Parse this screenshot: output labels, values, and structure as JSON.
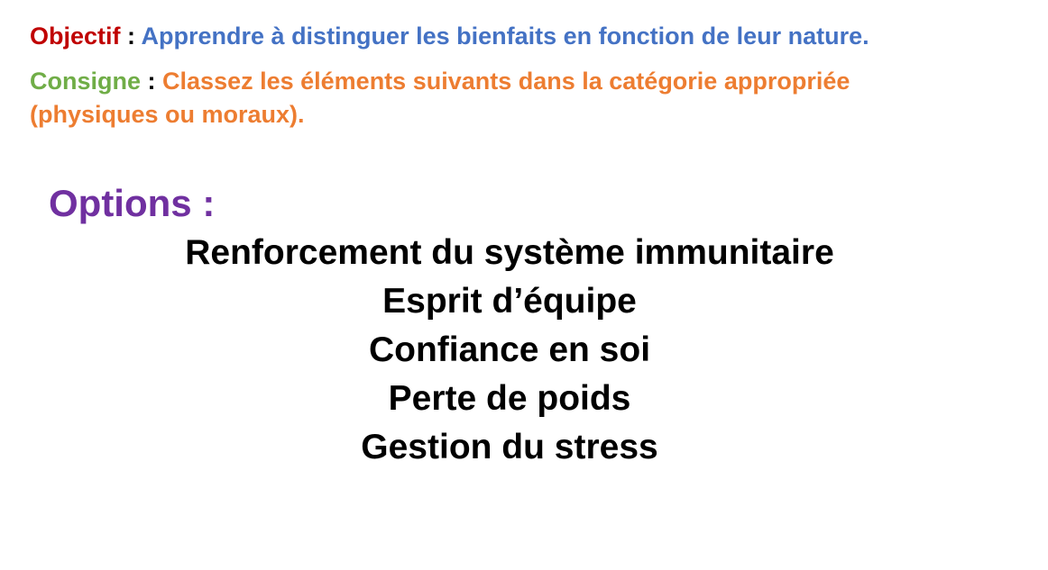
{
  "header": {
    "objective_label": "Objectif",
    "objective_text": "Apprendre à distinguer les bienfaits en fonction de leur nature.",
    "instruction_label": "Consigne",
    "instruction_text_line1": "Classez les éléments suivants dans la catégorie appropriée",
    "instruction_text_line2": "(physiques ou moraux).",
    "separator": ":"
  },
  "options": {
    "title": "Options :",
    "items": [
      "Renforcement du système immunitaire",
      "Esprit d’équipe",
      "Confiance en soi",
      "Perte de poids",
      "Gestion du stress"
    ]
  },
  "colors": {
    "objective_label": "#c00000",
    "objective_text": "#4472c4",
    "instruction_label": "#70ad47",
    "instruction_text": "#ed7d31",
    "options_title": "#7030a0"
  }
}
